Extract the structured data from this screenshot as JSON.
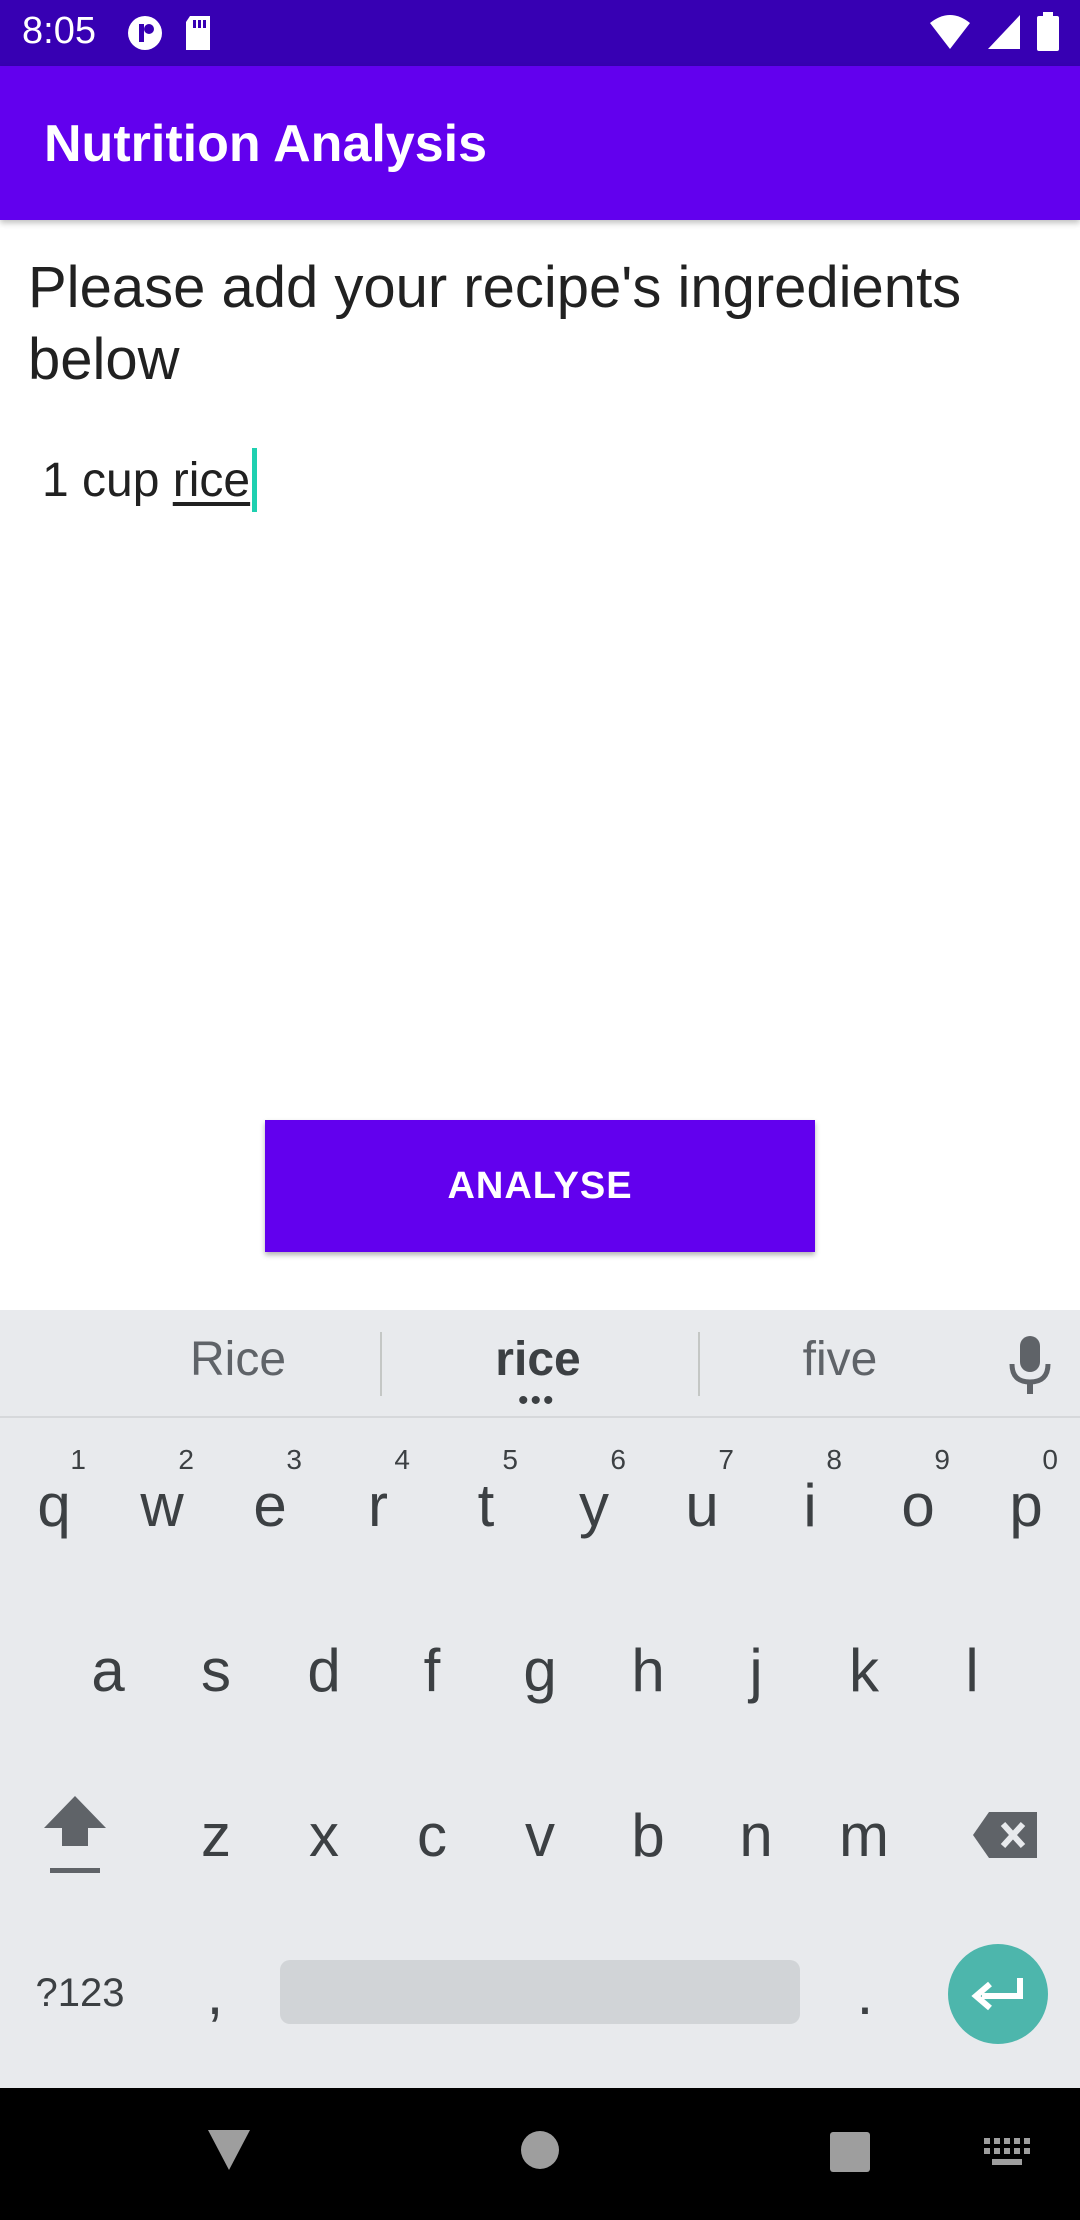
{
  "status_bar": {
    "time": "8:05"
  },
  "app_bar": {
    "title": "Nutrition Analysis"
  },
  "content": {
    "prompt": "Please add your recipe's ingredients below",
    "input_prefix": "1 cup ",
    "input_composing": "rice",
    "analyse_label": "ANALYSE"
  },
  "keyboard": {
    "suggestions": [
      "Rice",
      "rice",
      "five"
    ],
    "row1": [
      {
        "label": "q",
        "hint": "1"
      },
      {
        "label": "w",
        "hint": "2"
      },
      {
        "label": "e",
        "hint": "3"
      },
      {
        "label": "r",
        "hint": "4"
      },
      {
        "label": "t",
        "hint": "5"
      },
      {
        "label": "y",
        "hint": "6"
      },
      {
        "label": "u",
        "hint": "7"
      },
      {
        "label": "i",
        "hint": "8"
      },
      {
        "label": "o",
        "hint": "9"
      },
      {
        "label": "p",
        "hint": "0"
      }
    ],
    "row2": [
      "a",
      "s",
      "d",
      "f",
      "g",
      "h",
      "j",
      "k",
      "l"
    ],
    "row3": [
      "z",
      "x",
      "c",
      "v",
      "b",
      "n",
      "m"
    ],
    "symbols_label": "?123",
    "comma": ",",
    "period": "."
  },
  "colors": {
    "status_bar": "#3700B3",
    "primary": "#6200EE",
    "enter_key": "#4DB6AC",
    "cursor": "#1FD0B0"
  }
}
